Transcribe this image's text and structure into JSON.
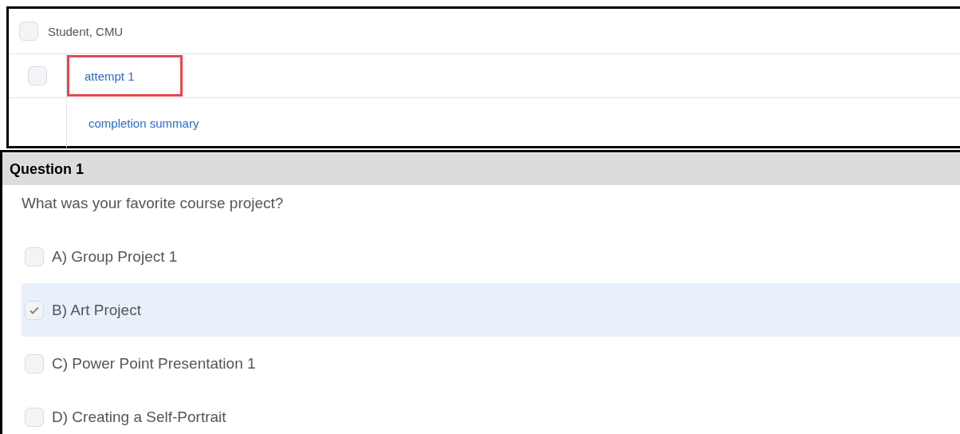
{
  "submission": {
    "student": {
      "name": "Student, CMU",
      "checked": false
    },
    "attempt": {
      "label": "attempt 1",
      "checked": false,
      "highlighted": true
    },
    "summary": {
      "label": "completion summary"
    }
  },
  "question": {
    "title": "Question 1",
    "prompt": "What was your favorite course project?",
    "options": [
      {
        "label": "A) Group Project 1",
        "checked": false,
        "selected": false
      },
      {
        "label": "B) Art Project",
        "checked": true,
        "selected": true
      },
      {
        "label": "C) Power Point Presentation 1",
        "checked": false,
        "selected": false
      },
      {
        "label": "D) Creating a Self-Portrait",
        "checked": false,
        "selected": false
      }
    ]
  }
}
